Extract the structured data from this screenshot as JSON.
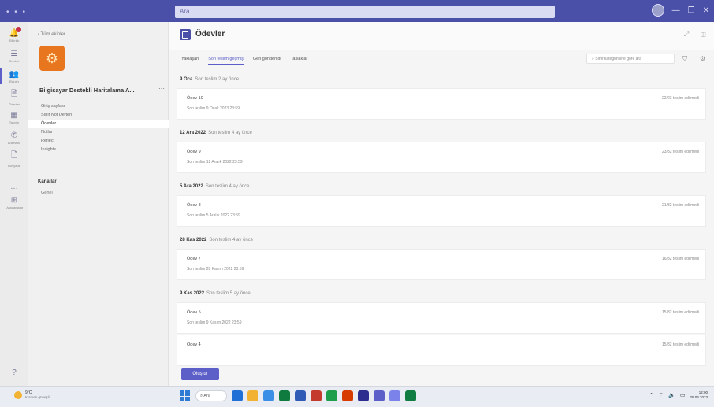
{
  "titlebar": {
    "search_placeholder": "Ara",
    "dots": "• • •",
    "minimize": "—",
    "maximize": "❐",
    "close": "✕"
  },
  "rail": {
    "items": [
      {
        "name": "activity",
        "label": "Etkinlik",
        "glyph": "🔔",
        "badge": true
      },
      {
        "name": "chat",
        "label": "Sohbet",
        "glyph": "☰"
      },
      {
        "name": "teams",
        "label": "Ekipler",
        "glyph": "👥",
        "active": true
      },
      {
        "name": "assignments",
        "label": "Ödevler",
        "glyph": "🗎"
      },
      {
        "name": "calendar",
        "label": "Takvim",
        "glyph": "▦"
      },
      {
        "name": "calls",
        "label": "Aramalar",
        "glyph": "✆"
      },
      {
        "name": "files",
        "label": "Dosyalar",
        "glyph": "🗋"
      },
      {
        "name": "more",
        "label": "",
        "glyph": "…"
      },
      {
        "name": "apps",
        "label": "Uygulamalar",
        "glyph": "⊞"
      }
    ],
    "help_glyph": "?"
  },
  "sidebar": {
    "back_label": "‹  Tüm ekipler",
    "team_name": "Bilgisayar Destekli Haritalama A...",
    "more": "···",
    "nav": [
      "Giriş sayfası",
      "Sınıf Not Defteri",
      "Ödevler",
      "Notlar",
      "Reflect",
      "Insights"
    ],
    "active_nav": 2,
    "channels_title": "Kanallar",
    "channel": "Genel"
  },
  "main": {
    "app_title": "Ödevler",
    "tabs": [
      "Yaklaşan",
      "Son teslim geçmiş",
      "Geri gönderildi",
      "Taslaklar"
    ],
    "active_tab": 1,
    "filter_placeholder": "Sınıf kategorisine göre ara",
    "groups": [
      {
        "date": "9 Oca",
        "meta": "Son teslim 2 ay önce",
        "title": "Ödev 10",
        "sub": "Son teslim 9 Ocak 2023 23:59",
        "right": "22/23 teslim edilmedi"
      },
      {
        "date": "12 Ara 2022",
        "meta": "Son teslim 4 ay önce",
        "title": "Ödev 9",
        "sub": "Son teslim 12 Aralık 2022 23:59",
        "right": "23/32 teslim edilmedi"
      },
      {
        "date": "5 Ara 2022",
        "meta": "Son teslim 4 ay önce",
        "title": "Ödev 8",
        "sub": "Son teslim 5 Aralık 2022 23:59",
        "right": "21/32 teslim edilmedi"
      },
      {
        "date": "28 Kas 2022",
        "meta": "Son teslim 4 ay önce",
        "title": "Ödev 7",
        "sub": "Son teslim 28 Kasım 2022 23:59",
        "right": "16/32 teslim edilmedi"
      },
      {
        "date": "9 Kas 2022",
        "meta": "Son teslim 5 ay önce",
        "title": "Ödev 5",
        "sub": "Son teslim 9 Kasım 2022 23:59",
        "right": "15/32 teslim edilmedi",
        "extra_title": "Ödev 4",
        "extra_right": "15/32 teslim edilmedi"
      }
    ],
    "create_label": "Oluştur"
  },
  "taskbar": {
    "temp": "9°C",
    "weather_desc": "Kısmen güneşli",
    "search_label": "Ara",
    "time": "12:00",
    "date": "25.03.2023",
    "app_colors": [
      "#1f6fd6",
      "#f2b233",
      "#3a8ee6",
      "#0f7b3f",
      "#2f5bb7",
      "#c43b2e",
      "#1e9e4a",
      "#d83b01",
      "#2d2d8f",
      "#5b5fc7",
      "#7b83eb",
      "#107c41"
    ]
  }
}
